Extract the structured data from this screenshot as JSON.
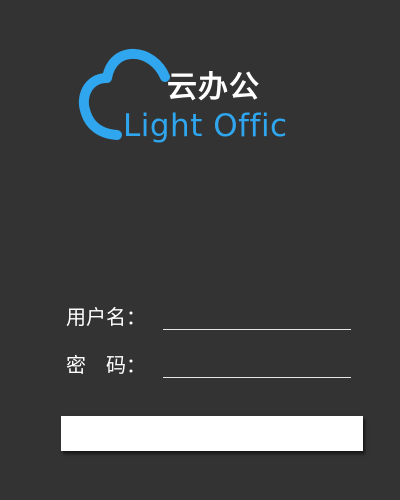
{
  "logo": {
    "name_cn": "云办公",
    "name_en": "Light Offic",
    "icon": "cloud-icon",
    "accent_color": "#2fa6ee"
  },
  "form": {
    "username": {
      "label": "用户名：",
      "value": "",
      "placeholder": ""
    },
    "password": {
      "label": "密　码：",
      "value": "",
      "placeholder": ""
    },
    "submit_label": ""
  },
  "colors": {
    "background": "#333333",
    "text": "#ffffff",
    "field_underline": "#e6e6e6",
    "button": "#ffffff"
  }
}
